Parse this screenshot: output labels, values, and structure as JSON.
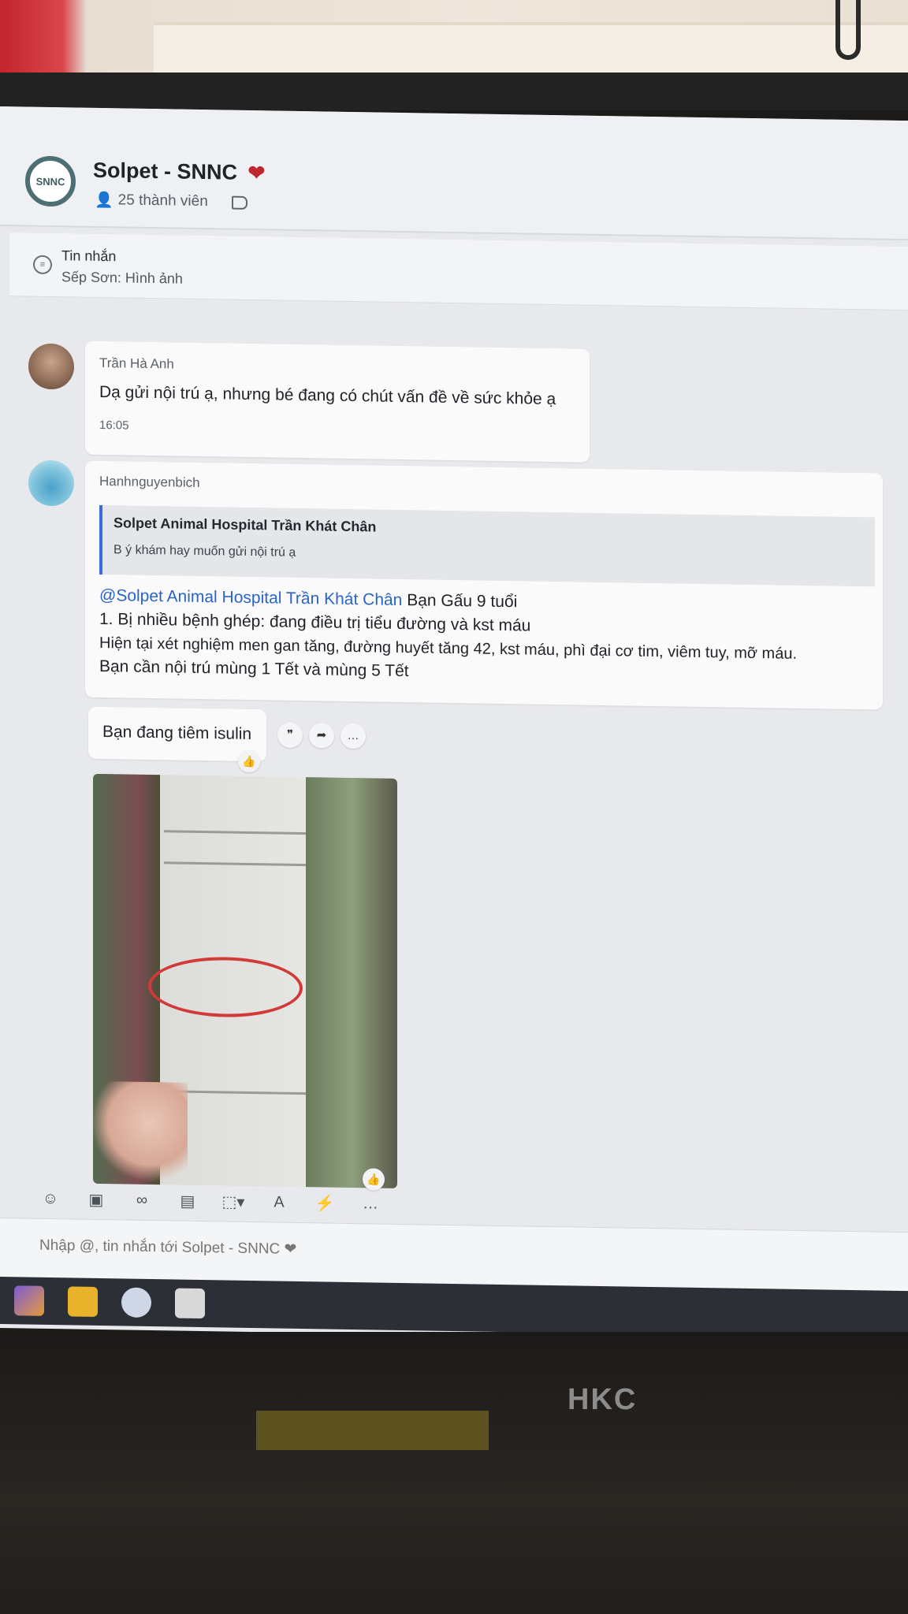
{
  "group": {
    "logo_text": "SNNC",
    "title": "Solpet - SNNC",
    "members": "25 thành viên"
  },
  "pinned": {
    "title": "Tin nhắn",
    "subtitle": "Sếp Sơn: Hình ảnh"
  },
  "messages": [
    {
      "sender": "Trần Hà Anh",
      "text": "Dạ gửi nội trú ạ, nhưng bé đang có chút vấn đề về sức khỏe ạ",
      "time": "16:05"
    },
    {
      "sender": "Hanhnguyenbich",
      "quote_title": "Solpet Animal Hospital Trần Khát Chân",
      "quote_text": "B ý khám hay muốn gửi nội trú ạ",
      "mention": "@Solpet Animal Hospital Trần Khát Chân",
      "line1_rest": " Bạn Gấu 9 tuổi",
      "line2": "1. Bị nhiều bệnh ghép: đang điều trị tiểu đường và kst máu",
      "line3": "Hiện tại xét nghiệm men gan tăng, đường huyết tăng 42, kst máu, phì đại cơ tim, viêm tuy, mỡ máu.",
      "line4": "Bạn cần nội trú mùng 1 Tết và mùng 5 Tết"
    },
    {
      "text": "Bạn đang tiêm isulin"
    }
  ],
  "composer": {
    "placeholder": "Nhập @, tin nhắn tới Solpet - SNNC ❤"
  },
  "monitor": {
    "brand": "HKC"
  },
  "colors": {
    "accent": "#2b64c9",
    "heart": "#c0262d"
  }
}
